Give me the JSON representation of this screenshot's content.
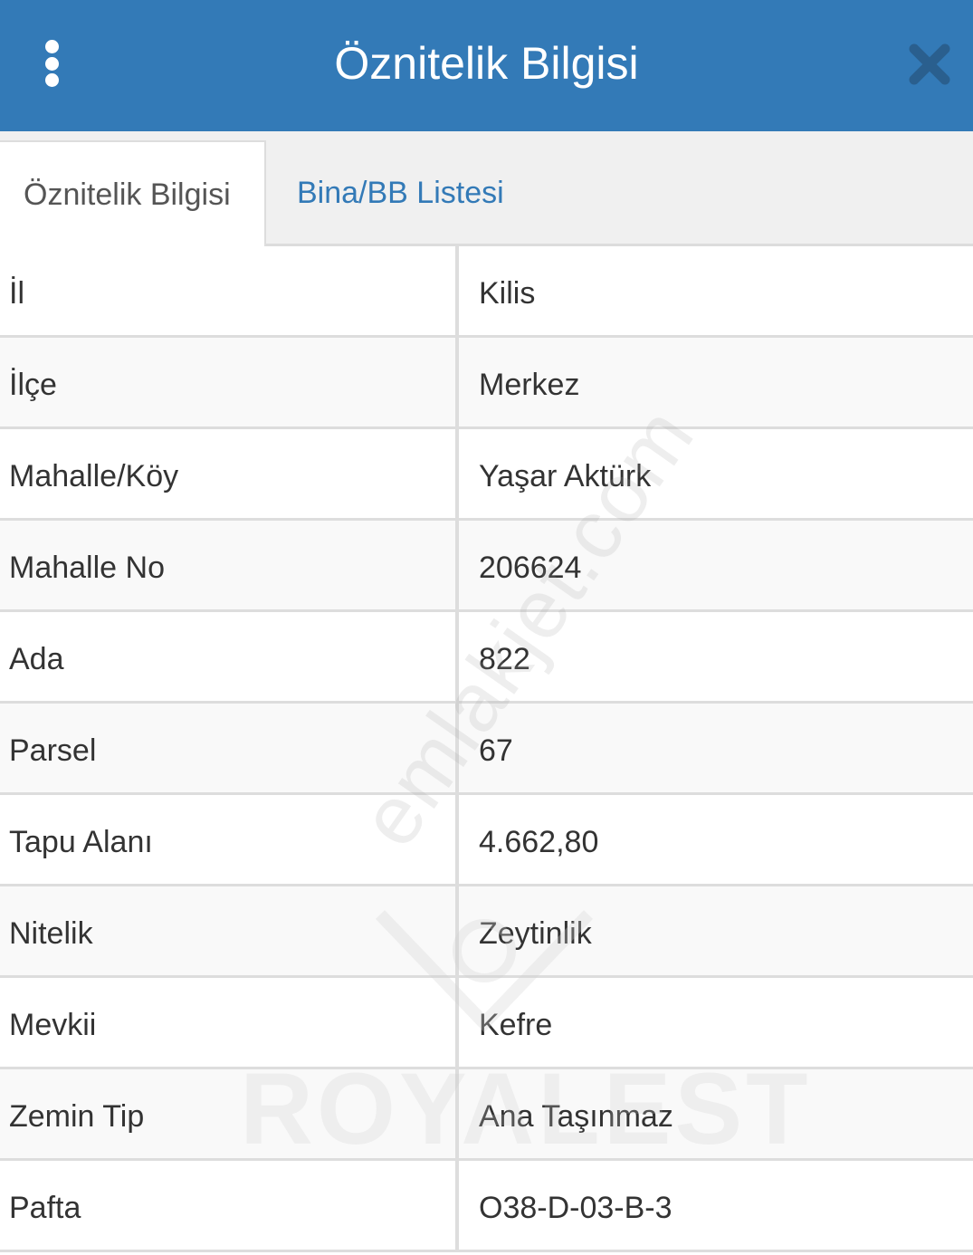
{
  "header": {
    "title": "Öznitelik Bilgisi",
    "menu_icon": "more-vertical-icon",
    "close_icon": "close-icon",
    "color": "#337ab7"
  },
  "tabs": [
    {
      "label": "Öznitelik Bilgisi",
      "active": true
    },
    {
      "label": "Bina/BB Listesi",
      "active": false
    }
  ],
  "rows": [
    {
      "label": "İl",
      "value": "Kilis"
    },
    {
      "label": "İlçe",
      "value": "Merkez"
    },
    {
      "label": "Mahalle/Köy",
      "value": "Yaşar Aktürk"
    },
    {
      "label": "Mahalle No",
      "value": "206624"
    },
    {
      "label": "Ada",
      "value": "822"
    },
    {
      "label": "Parsel",
      "value": "67"
    },
    {
      "label": "Tapu Alanı",
      "value": "4.662,80"
    },
    {
      "label": "Nitelik",
      "value": "Zeytinlik"
    },
    {
      "label": "Mevkii",
      "value": "Kefre"
    },
    {
      "label": "Zemin Tip",
      "value": "Ana Taşınmaz"
    },
    {
      "label": "Pafta",
      "value": "O38-D-03-B-3"
    }
  ],
  "watermarks": {
    "site": "emlakjet.com",
    "logo": "ROYALEST"
  }
}
